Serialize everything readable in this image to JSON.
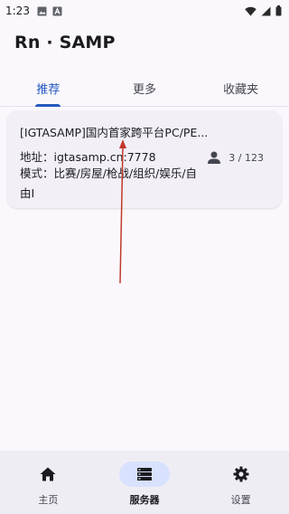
{
  "status_bar": {
    "time": "1:23"
  },
  "app": {
    "title": "Rn · SAMP"
  },
  "tabs": [
    {
      "label": "推荐",
      "active": true
    },
    {
      "label": "更多",
      "active": false
    },
    {
      "label": "收藏夹",
      "active": false
    }
  ],
  "server": {
    "name": "[IGTASAMP]国内首家跨平台PC/PE...",
    "address": "地址：igtasamp.cn:7778",
    "mode_line1": "模式：比赛/房屋/枪战/组织/娱乐/自",
    "mode_line2": "由I",
    "players": "3 / 123"
  },
  "bottom_nav": [
    {
      "label": "主页",
      "icon": "home-icon",
      "active": false
    },
    {
      "label": "服务器",
      "icon": "server-list-icon",
      "active": true
    },
    {
      "label": "设置",
      "icon": "gear-icon",
      "active": false
    }
  ],
  "colors": {
    "accent": "#2458bf",
    "annotation": "#c0392b",
    "nav_active_pill": "#d8e2ff"
  }
}
